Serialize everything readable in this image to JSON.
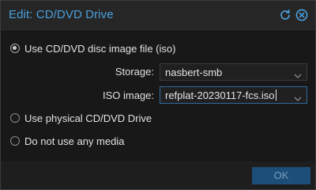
{
  "dialog": {
    "title": "Edit: CD/DVD Drive",
    "accent_color": "#4a9fdc"
  },
  "options": {
    "iso": {
      "label": "Use CD/DVD disc image file (iso)",
      "checked": true
    },
    "physical": {
      "label": "Use physical CD/DVD Drive",
      "checked": false
    },
    "none": {
      "label": "Do not use any media",
      "checked": false
    }
  },
  "storage": {
    "label": "Storage:",
    "value": "nasbert-smb"
  },
  "iso_image": {
    "label": "ISO image:",
    "value": "refplat-20230117-fcs.iso"
  },
  "footer": {
    "ok_label": "OK"
  },
  "icons": {
    "reset": "reset-icon",
    "close": "close-icon",
    "dropdown": "chevron-down-icon"
  }
}
